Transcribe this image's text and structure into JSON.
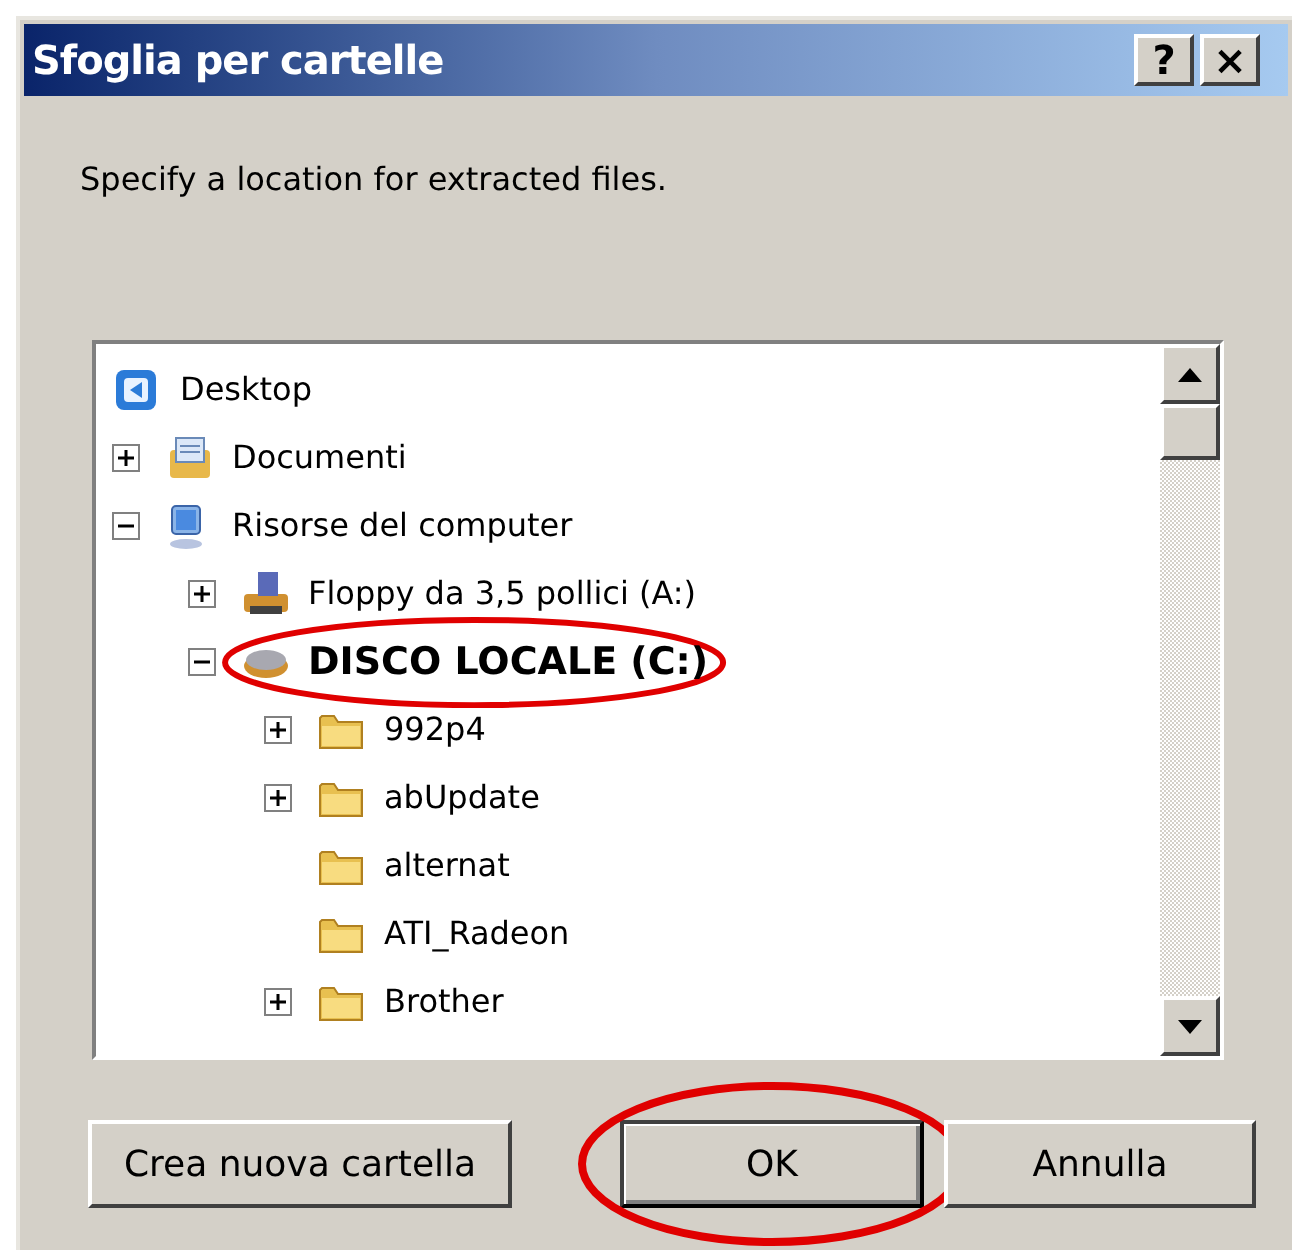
{
  "window": {
    "title": "Sfoglia per cartelle",
    "title_buttons": [
      "?",
      "×"
    ]
  },
  "prompt": "Specify a location for extracted files.",
  "tree": [
    {
      "label": "Desktop",
      "kind": "desktop",
      "selected": false,
      "circled": false,
      "children": [
        {
          "label": "Documenti",
          "kind": "documents",
          "has_children": true,
          "expanded": false,
          "selected": false,
          "circled": false
        },
        {
          "label": "Risorse del computer",
          "kind": "computer",
          "has_children": true,
          "expanded": true,
          "selected": false,
          "circled": false,
          "children": [
            {
              "label": "Floppy da 3,5 pollici (A:)",
              "kind": "floppy",
              "has_children": true,
              "expanded": false,
              "selected": false,
              "circled": false
            },
            {
              "label": "DISCO LOCALE (C:)",
              "kind": "drive",
              "has_children": true,
              "expanded": true,
              "selected": true,
              "circled": true,
              "children": [
                {
                  "label": "992p4",
                  "kind": "folder",
                  "has_children": true,
                  "expanded": false,
                  "selected": false,
                  "circled": false
                },
                {
                  "label": "abUpdate",
                  "kind": "folder",
                  "has_children": true,
                  "expanded": false,
                  "selected": false,
                  "circled": false
                },
                {
                  "label": "alternat",
                  "kind": "folder",
                  "has_children": false,
                  "selected": false,
                  "circled": false
                },
                {
                  "label": "ATI_Radeon",
                  "kind": "folder",
                  "has_children": false,
                  "selected": false,
                  "circled": false
                },
                {
                  "label": "Brother",
                  "kind": "folder",
                  "has_children": true,
                  "expanded": false,
                  "selected": false,
                  "circled": false
                }
              ]
            }
          ]
        }
      ]
    }
  ],
  "buttons": [
    {
      "label": "Crea nuova cartella",
      "default": false,
      "circled": false
    },
    {
      "label": "OK",
      "default": true,
      "circled": true
    },
    {
      "label": "Annulla",
      "default": false,
      "circled": false
    }
  ]
}
